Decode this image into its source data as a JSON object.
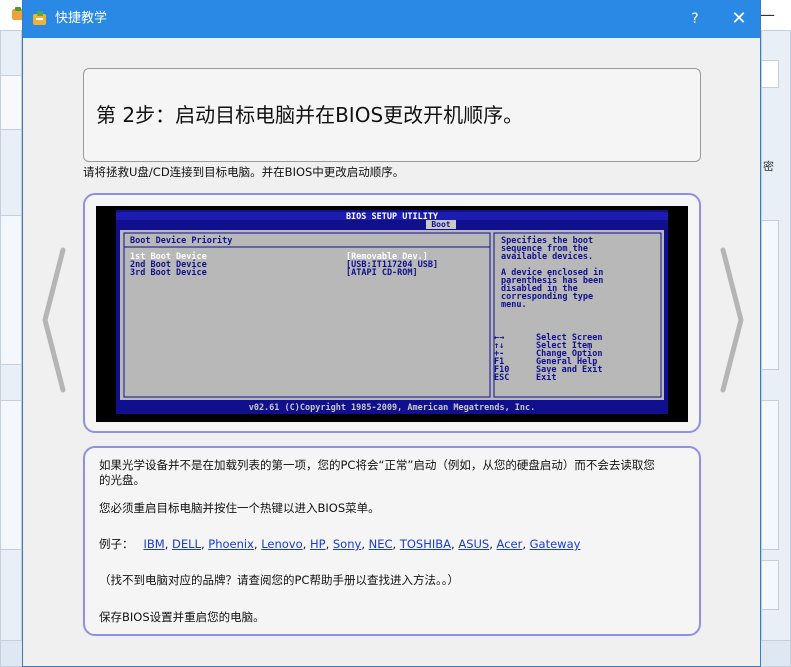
{
  "background_window": {
    "minimize_glyph": "—",
    "restore_glyph": "❐",
    "right_edge_text": "密"
  },
  "dialog": {
    "title": "快捷教学",
    "help_label": "?",
    "close_label": "✕",
    "step_title": "第 2步：启动目标电脑并在BIOS更改开机顺序。",
    "instruction": "请将拯救U盘/CD连接到目标电脑。并在BIOS中更改启动顺序。",
    "bios": {
      "header": "BIOS SETUP UTILITY",
      "tab": "Boot",
      "section_title": "Boot Device Priority",
      "devices": [
        {
          "label": "1st Boot Device",
          "value": "[Removable Dev.]"
        },
        {
          "label": "2nd Boot Device",
          "value": "[USB:IT117204 USB]"
        },
        {
          "label": "3rd Boot Device",
          "value": "[ATAPI CD-ROM]"
        }
      ],
      "help_lines": [
        "Specifies the boot",
        "sequence from the",
        "available devices.",
        "",
        "A device enclosed in",
        "parenthesis has been",
        "disabled in the",
        "corresponding type",
        "menu."
      ],
      "keys": [
        {
          "key": "←→",
          "action": "Select Screen"
        },
        {
          "key": "↑↓",
          "action": "Select Item"
        },
        {
          "key": "+-",
          "action": "Change Option"
        },
        {
          "key": "F1",
          "action": "General Help"
        },
        {
          "key": "F10",
          "action": "Save and Exit"
        },
        {
          "key": "ESC",
          "action": "Exit"
        }
      ],
      "footer": "v02.61 (C)Copyright 1985-2009, American Megatrends, Inc."
    },
    "info": {
      "para1_line1": "如果光学设备并不是在加载列表的第一项，您的PC将会“正常”启动（例如，从您的硬盘启动）而不会去读取您",
      "para1_line2": "的光盘。",
      "para2": "您必须重启目标电脑并按住一个热键以进入BIOS菜单。",
      "examples_label": "例子：",
      "brands": [
        "IBM",
        "DELL",
        "Phoenix",
        "Lenovo",
        "HP",
        "Sony",
        "NEC",
        "TOSHIBA",
        "ASUS",
        "Acer",
        "Gateway"
      ],
      "para4": "（找不到电脑对应的品牌？请查阅您的PC帮助手册以查找进入方法。。）",
      "para5": "保存BIOS设置并重启您的电脑。"
    }
  }
}
